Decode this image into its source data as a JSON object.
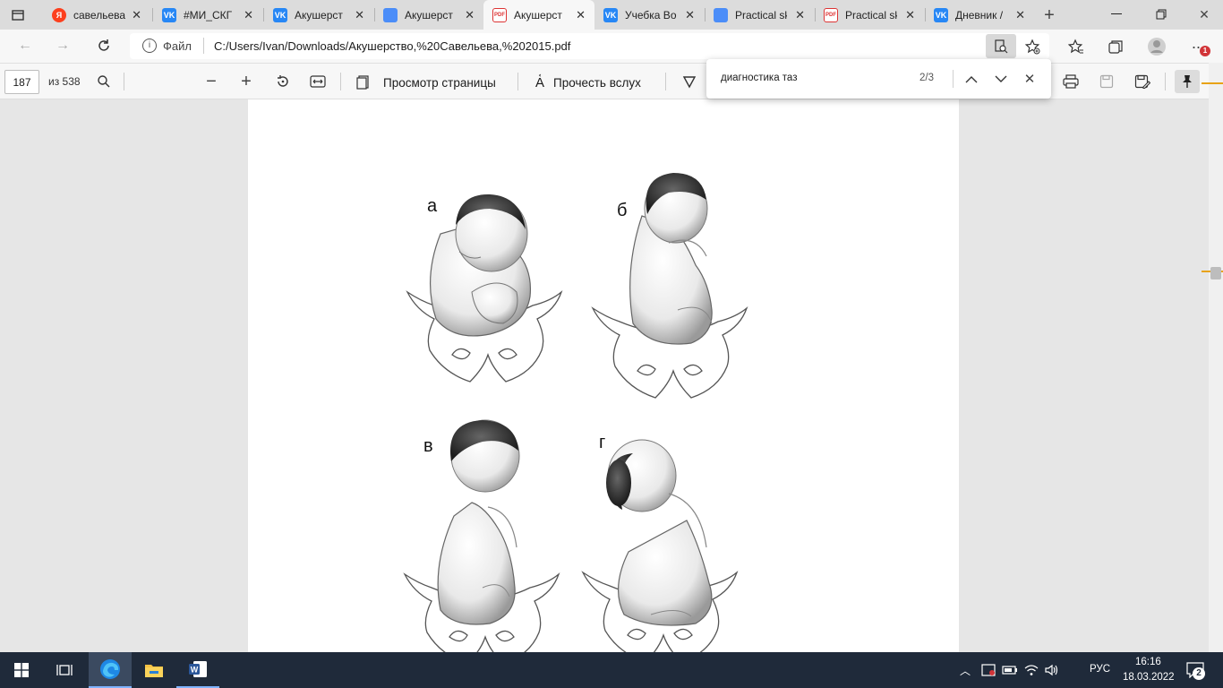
{
  "tabs": [
    {
      "label": "савельева",
      "icon": "yandex-icon"
    },
    {
      "label": "#МИ_СКГ",
      "icon": "vk-icon"
    },
    {
      "label": "Акушерст",
      "icon": "vk-icon"
    },
    {
      "label": "Акушерст",
      "icon": "doc-icon"
    },
    {
      "label": "Акушерст",
      "icon": "pdf-icon"
    },
    {
      "label": "Учебка Во",
      "icon": "vk-icon"
    },
    {
      "label": "Practical sk",
      "icon": "doc-icon"
    },
    {
      "label": "Practical sk",
      "icon": "pdf-icon"
    },
    {
      "label": "Дневник /",
      "icon": "vk-icon"
    }
  ],
  "active_tab_index": 4,
  "address": {
    "scheme_label": "Файл",
    "url": "C:/Users/Ivan/Downloads/Акушерство,%20Савельева,%202015.pdf"
  },
  "notification_badge": "1",
  "pdf_toolbar": {
    "page_number": "187",
    "page_total": "из 538",
    "page_view_label": "Просмотр страницы",
    "read_aloud_label": "Прочесть вслух"
  },
  "find": {
    "query": "диагностика таз",
    "result": "2/3"
  },
  "figure_labels": [
    "а",
    "б",
    "в",
    "г"
  ],
  "taskbar": {
    "language": "РУС",
    "time": "16:16",
    "date": "18.03.2022",
    "notifications_count": "2"
  },
  "colors": {
    "accent_vk": "#2787f5",
    "yandex": "#fc3f1d",
    "pdf_red": "#d33333",
    "taskbar": "#1f2a3a"
  }
}
